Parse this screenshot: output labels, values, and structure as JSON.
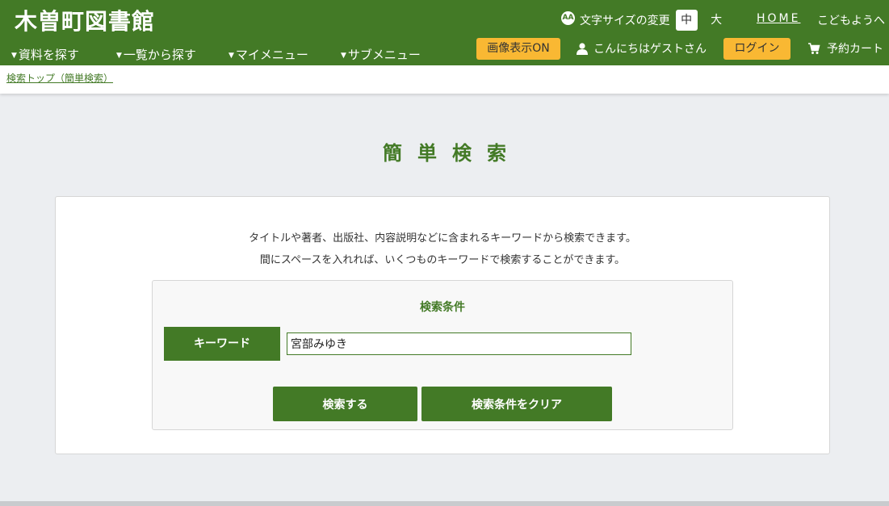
{
  "header": {
    "site_title": "木曽町図書館",
    "nav": [
      "資料を探す",
      "一覧から探す",
      "マイメニュー",
      "サブメニュー"
    ],
    "font_size": {
      "icon_text": "AA",
      "label": "文字サイズの変更",
      "medium": "中",
      "large": "大"
    },
    "home": "HOME",
    "kids": "こどもようへ",
    "image_display": "画像表示ON",
    "greeting": "こんにちはゲストさん",
    "login": "ログイン",
    "cart": "予約カート"
  },
  "breadcrumb": "検索トップ（簡単検索）",
  "page_title": "簡単検索",
  "description": [
    "タイトルや著者、出版社、内容説明などに含まれるキーワードから検索できます。",
    "間にスペースを入れれば、いくつものキーワードで検索することができます。"
  ],
  "conditions": {
    "title": "検索条件",
    "keyword_label": "キーワード",
    "keyword_value": "宮部みゆき",
    "search_button": "検索する",
    "clear_button": "検索条件をクリア"
  },
  "colors": {
    "brand_green": "#437a26",
    "accent_yellow": "#f9b833",
    "background": "#eceef1"
  }
}
